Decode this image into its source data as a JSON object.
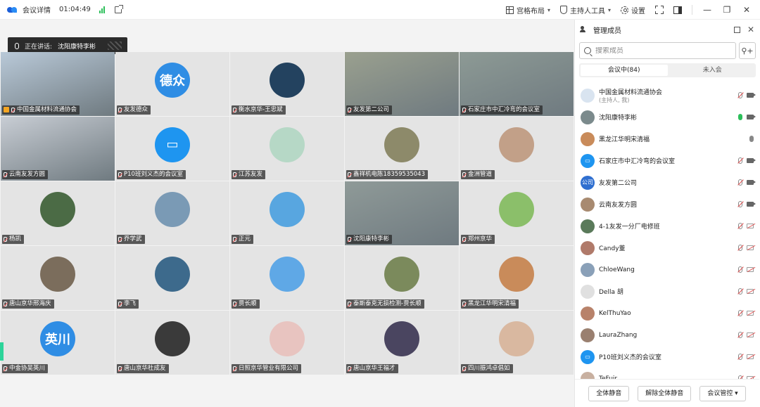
{
  "titlebar": {
    "title": "会议详情",
    "time": "01:04:49",
    "layout_label": "宫格布局",
    "host_tools_label": "主持人工具",
    "settings_label": "设置",
    "minimize": "—",
    "restore": "❐",
    "close": "✕"
  },
  "speaking": {
    "label": "正在讲话:",
    "name": "沈阳康特李彬"
  },
  "tiles": [
    {
      "name": "中国金属材料流通协会",
      "kind": "photo",
      "color": "#b9c9d8",
      "host": true
    },
    {
      "name": "友发德众",
      "kind": "avatar",
      "text": "德众",
      "color": "#2f8de4"
    },
    {
      "name": "衡水京华-王忠斌",
      "kind": "avatar",
      "text": "",
      "color": "#23425f"
    },
    {
      "name": "友发第二公司",
      "kind": "photo",
      "color": "#9aa08f"
    },
    {
      "name": "石家庄市中汇冷弯的会议室",
      "kind": "photo",
      "color": "#8d9a95"
    },
    {
      "name": "云南友发方圆",
      "kind": "photo",
      "color": "#c8cdd4"
    },
    {
      "name": "P10班刘义杰的会议室",
      "kind": "avatar",
      "text": "▭",
      "color": "#1e95f0"
    },
    {
      "name": "江苏友发",
      "kind": "avatar",
      "text": "",
      "color": "#b6d8c6"
    },
    {
      "name": "鑫祥机电陈18359535043",
      "kind": "avatar",
      "text": "",
      "color": "#8d8a6a"
    },
    {
      "name": "金洲管道",
      "kind": "avatar",
      "text": "",
      "color": "#c2a088"
    },
    {
      "name": "杨凯",
      "kind": "avatar",
      "text": "",
      "color": "#4b6b45"
    },
    {
      "name": "乔学武",
      "kind": "avatar",
      "text": "",
      "color": "#7a9ab5"
    },
    {
      "name": "正元",
      "kind": "avatar",
      "text": "",
      "color": "#58a6e0"
    },
    {
      "name": "沈阳康特李彬",
      "kind": "photo",
      "color": "#8f9a98",
      "active": true
    },
    {
      "name": "郑州京华",
      "kind": "avatar",
      "text": "",
      "color": "#8bbf6a"
    },
    {
      "name": "唐山京华邢海庆",
      "kind": "avatar",
      "text": "",
      "color": "#7b6d5c"
    },
    {
      "name": "李飞",
      "kind": "avatar",
      "text": "",
      "color": "#3d6a8c"
    },
    {
      "name": "贾长顺",
      "kind": "avatar",
      "text": "",
      "color": "#5fa8e6"
    },
    {
      "name": "泰斯泰克无损检测-贾长顺",
      "kind": "avatar",
      "text": "",
      "color": "#7b8a5c"
    },
    {
      "name": "黑龙江华明宋清福",
      "kind": "avatar",
      "text": "",
      "color": "#c98b5a"
    },
    {
      "name": "中金协吴英川",
      "kind": "avatar",
      "text": "英川",
      "color": "#2f8de4"
    },
    {
      "name": "唐山京华杜成友",
      "kind": "avatar",
      "text": "",
      "color": "#3a3a3a"
    },
    {
      "name": "日照京华管业有限公司",
      "kind": "avatar",
      "text": "",
      "color": "#e8c4c0"
    },
    {
      "name": "唐山京华王福才",
      "kind": "avatar",
      "text": "",
      "color": "#4a4560"
    },
    {
      "name": "四川振鸿卓倡如",
      "kind": "avatar",
      "text": "",
      "color": "#d9b8a0"
    }
  ],
  "panel": {
    "title": "管理成员",
    "search_placeholder": "搜索成员",
    "tab_in": "会议中(84)",
    "tab_out": "未入会",
    "mute_all": "全体静音",
    "unmute_all": "解除全体静音",
    "control": "会议管控 ▾"
  },
  "members": [
    {
      "name": "中国金属材料流通协会",
      "sub": "(主持人, 我)",
      "color": "#d9e4f0",
      "text": "",
      "mic": "off",
      "cam": "on"
    },
    {
      "name": "沈阳康特李彬",
      "sub": "",
      "color": "#7b8a8c",
      "text": "",
      "mic": "on",
      "cam": "on"
    },
    {
      "name": "黑龙江华明宋清福",
      "sub": "",
      "color": "#c98b5a",
      "text": "",
      "mic": "idle",
      "cam": "none"
    },
    {
      "name": "石家庄市中汇冷弯的会议室",
      "sub": "",
      "color": "#1e95f0",
      "text": "▭",
      "mic": "off",
      "cam": "on"
    },
    {
      "name": "友发第二公司",
      "sub": "",
      "color": "#2f6fd0",
      "text": "公司",
      "mic": "off",
      "cam": "on"
    },
    {
      "name": "云南友发方圆",
      "sub": "",
      "color": "#a88a70",
      "text": "",
      "mic": "off",
      "cam": "on"
    },
    {
      "name": "4-1友发一分厂电修班",
      "sub": "",
      "color": "#5a7a5a",
      "text": "",
      "mic": "off",
      "cam": "off"
    },
    {
      "name": "Candy董",
      "sub": "",
      "color": "#b07a6a",
      "text": "",
      "mic": "off",
      "cam": "off"
    },
    {
      "name": "ChloeWang",
      "sub": "",
      "color": "#8aa0b8",
      "text": "",
      "mic": "off",
      "cam": "off"
    },
    {
      "name": "Della 胡",
      "sub": "",
      "color": "#e0e0e0",
      "text": "",
      "mic": "off",
      "cam": "off"
    },
    {
      "name": "KelThuYao",
      "sub": "",
      "color": "#b8826a",
      "text": "",
      "mic": "off",
      "cam": "off"
    },
    {
      "name": "LauraZhang",
      "sub": "",
      "color": "#9a8070",
      "text": "",
      "mic": "off",
      "cam": "off"
    },
    {
      "name": "P10班刘义杰的会议室",
      "sub": "",
      "color": "#1e95f0",
      "text": "▭",
      "mic": "off",
      "cam": "off"
    },
    {
      "name": "TeFuir",
      "sub": "",
      "color": "#c8b0a0",
      "text": "",
      "mic": "off",
      "cam": "off"
    }
  ]
}
